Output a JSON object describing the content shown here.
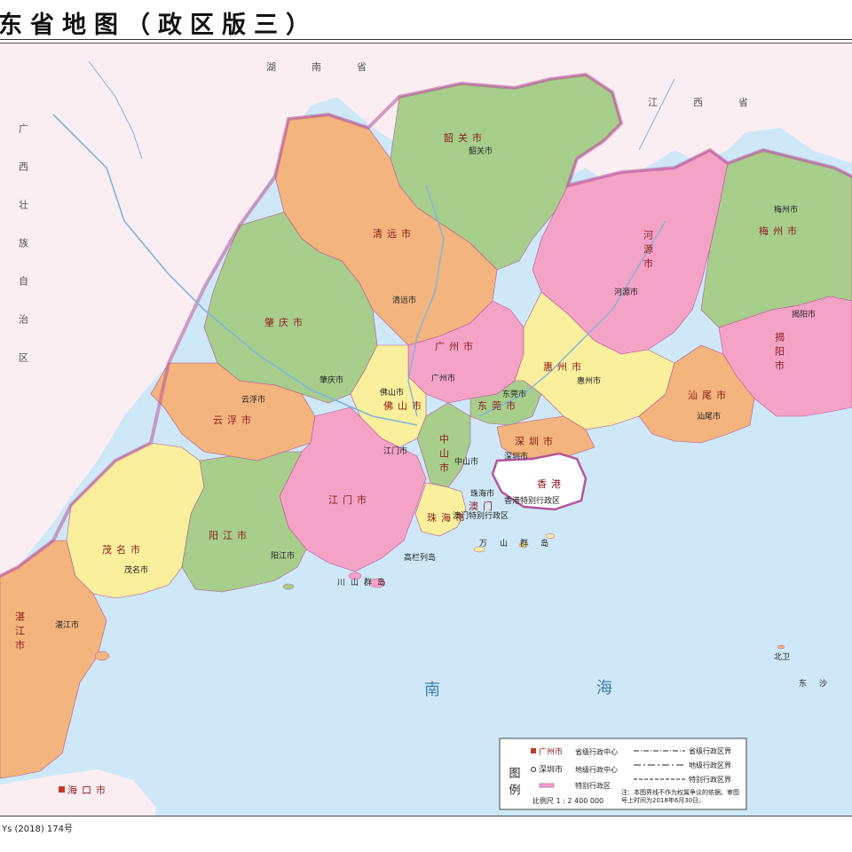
{
  "title": "东省地图（政区版三）",
  "approval_number": "Ys (2018) 174号",
  "colors": {
    "sea": "#cfe8f7",
    "outside": "#fbeef2",
    "orange": "#f3b47d",
    "green": "#a8ce8c",
    "pink": "#f4a3c6",
    "yellow": "#f9ef9c",
    "river": "#7fb3de",
    "boundary": "#b6559b"
  },
  "neighbors": [
    {
      "name": "湖南省"
    },
    {
      "name": "江西省"
    },
    {
      "name": "广西壮族自治区"
    }
  ],
  "cities": [
    {
      "name": "韶关市",
      "seat": "韶关市",
      "color": "green"
    },
    {
      "name": "清远市",
      "seat": "清远市",
      "color": "orange"
    },
    {
      "name": "河源市",
      "seat": "河源市",
      "color": "pink"
    },
    {
      "name": "梅州市",
      "seat": "梅州市",
      "color": "green"
    },
    {
      "name": "肇庆市",
      "seat": "肇庆市",
      "color": "green"
    },
    {
      "name": "广州市",
      "seat": "广州市",
      "color": "pink"
    },
    {
      "name": "惠州市",
      "seat": "惠州市",
      "color": "yellow"
    },
    {
      "name": "揭阳市",
      "seat": "揭阳市",
      "color": "pink"
    },
    {
      "name": "汕尾市",
      "seat": "汕尾市",
      "color": "orange"
    },
    {
      "name": "云浮市",
      "seat": "云浮市",
      "color": "orange"
    },
    {
      "name": "佛山市",
      "seat": "佛山市",
      "color": "yellow"
    },
    {
      "name": "东莞市",
      "seat": "东莞市",
      "color": "green"
    },
    {
      "name": "深圳市",
      "seat": "深圳市",
      "color": "orange"
    },
    {
      "name": "江门市",
      "seat": "江门市",
      "color": "pink"
    },
    {
      "name": "中山市",
      "seat": "中山市",
      "color": "green"
    },
    {
      "name": "珠海市",
      "seat": "珠海市",
      "color": "yellow"
    },
    {
      "name": "茂名市",
      "seat": "茂名市",
      "color": "yellow"
    },
    {
      "name": "阳江市",
      "seat": "阳江市",
      "color": "green"
    },
    {
      "name": "湛江市",
      "seat": "湛江市",
      "color": "orange"
    }
  ],
  "special_regions": [
    {
      "name": "香港",
      "label": "香港特别行政区"
    },
    {
      "name": "澳门",
      "label": "澳门特别行政区"
    }
  ],
  "islands": [
    "万山群岛",
    "川山群岛",
    "高栏列岛",
    "东沙",
    "北卫"
  ],
  "sea": {
    "name_left": "南",
    "name_right": "海"
  },
  "hainan": {
    "name": "海口市"
  },
  "legend": {
    "heading": "图例",
    "items": [
      {
        "sample": "广州市",
        "text": "省级行政中心"
      },
      {
        "sample": "深圳市",
        "text": "地级行政中心"
      },
      {
        "sample": "",
        "text": "特别行政区"
      },
      {
        "sample": "",
        "text": "省级行政区界"
      },
      {
        "sample": "",
        "text": "地级行政区界"
      },
      {
        "sample": "",
        "text": "特别行政区界"
      }
    ],
    "scale": "比例尺 1 : 2 400 000",
    "note": "注：本图界线不作为权属争议的依据。审图号上时间为2018年6月30日。"
  }
}
